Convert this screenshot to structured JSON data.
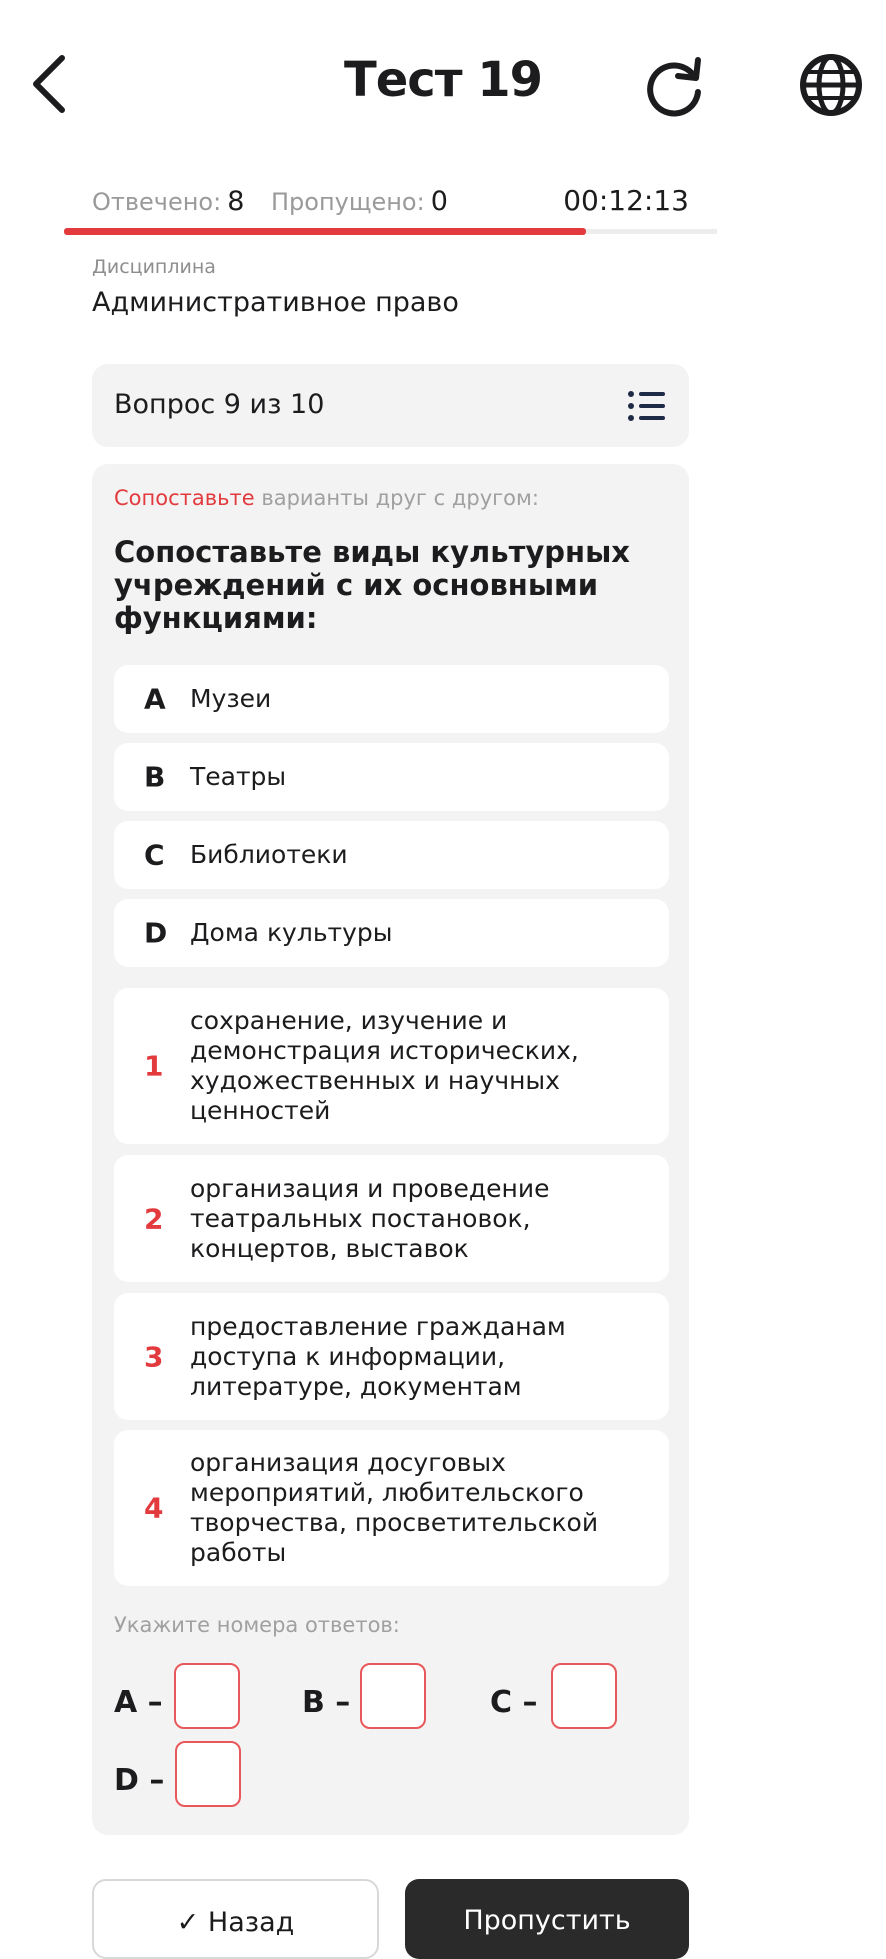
{
  "header": {
    "title": "Тест 19",
    "back_icon": "chevron-left-icon",
    "refresh_icon": "refresh-icon",
    "language_icon": "globe-icon"
  },
  "progress": {
    "answered_label": "Отвечено:",
    "answered_value": "8",
    "skipped_label": "Пропущено:",
    "skipped_value": "0",
    "timer": "00:12:13",
    "fraction": 0.8
  },
  "discipline": {
    "label": "Дисциплина",
    "name": "Административное право"
  },
  "counter": {
    "text": "Вопрос 9 из 10",
    "icon": "list-icon"
  },
  "question": {
    "instruction_accent": "Сопоставьте",
    "instruction_rest": " варианты друг с другом:",
    "text": "Сопоставьте виды культурных учреждений с их основными функциями:",
    "items": [
      {
        "key": "A",
        "text": "Музеи"
      },
      {
        "key": "B",
        "text": "Театры"
      },
      {
        "key": "C",
        "text": "Библиотеки"
      },
      {
        "key": "D",
        "text": "Дома культуры"
      }
    ],
    "answers": [
      {
        "key": "1",
        "text": "сохранение, изучение и демонстрация исторических, художественных и научных ценностей"
      },
      {
        "key": "2",
        "text": "организация и проведение театральных постановок, концертов, выставок"
      },
      {
        "key": "3",
        "text": "предоставление гражданам доступа к информации, литературе, документам"
      },
      {
        "key": "4",
        "text": "организация досуговых мероприятий, любительского творчества, просветительской работы"
      }
    ],
    "hint": "Укажите номера ответов:",
    "inputs": [
      {
        "label": "A –",
        "value": ""
      },
      {
        "label": "B –",
        "value": ""
      },
      {
        "label": "C –",
        "value": ""
      },
      {
        "label": "D –",
        "value": ""
      }
    ]
  },
  "footer": {
    "back_label": "Назад",
    "skip_label": "Пропустить"
  },
  "colors": {
    "accent": "#e33a3e",
    "card": "#f3f3f3",
    "dark_button": "#2a2a2a"
  }
}
